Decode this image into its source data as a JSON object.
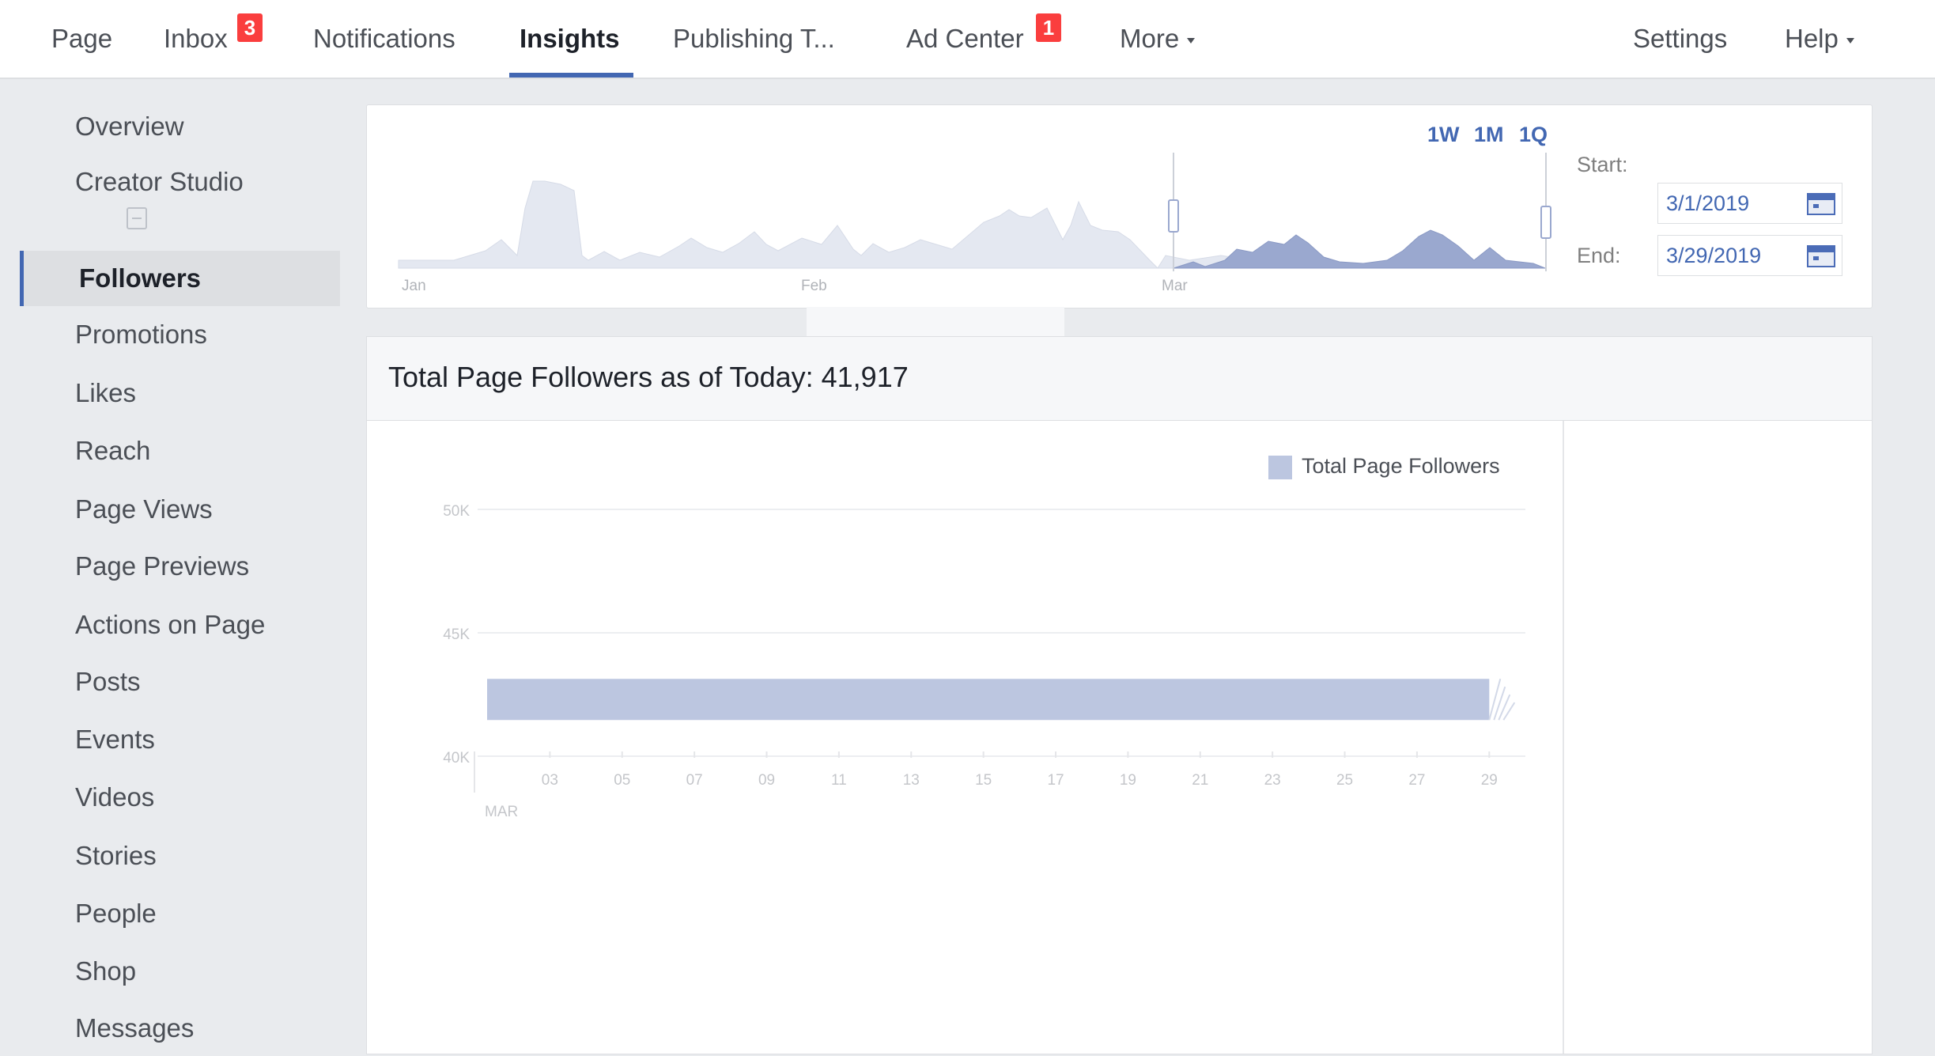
{
  "topnav": {
    "items": [
      {
        "label": "Page"
      },
      {
        "label": "Inbox",
        "badge": "3"
      },
      {
        "label": "Notifications"
      },
      {
        "label": "Insights",
        "active": true
      },
      {
        "label": "Publishing T..."
      },
      {
        "label": "Ad Center",
        "badge": "1"
      },
      {
        "label": "More"
      },
      {
        "label": "Settings"
      },
      {
        "label": "Help"
      }
    ]
  },
  "sidebar": {
    "items": [
      {
        "label": "Overview"
      },
      {
        "label": "Creator Studio"
      },
      {
        "label": "Followers",
        "active": true
      },
      {
        "label": "Promotions"
      },
      {
        "label": "Likes"
      },
      {
        "label": "Reach"
      },
      {
        "label": "Page Views"
      },
      {
        "label": "Page Previews"
      },
      {
        "label": "Actions on Page"
      },
      {
        "label": "Posts"
      },
      {
        "label": "Events"
      },
      {
        "label": "Videos"
      },
      {
        "label": "Stories"
      },
      {
        "label": "People"
      },
      {
        "label": "Shop"
      },
      {
        "label": "Messages"
      }
    ]
  },
  "range": {
    "buttons": [
      "1W",
      "1M",
      "1Q"
    ],
    "start_label": "Start:",
    "end_label": "End:",
    "start_date": "3/1/2019",
    "end_date": "3/29/2019",
    "overview_months": [
      "Jan",
      "Feb",
      "Mar"
    ]
  },
  "summary": {
    "title": "Total Page Followers as of Today: 41,917"
  },
  "chart_data": {
    "type": "area",
    "title": "",
    "legend": [
      "Total Page Followers"
    ],
    "legend_position": "top-right",
    "y_ticks": [
      "50K",
      "45K",
      "40K"
    ],
    "ylim": [
      40000,
      50000
    ],
    "x_ticks": [
      "03",
      "05",
      "07",
      "09",
      "11",
      "13",
      "15",
      "17",
      "19",
      "21",
      "23",
      "25",
      "27",
      "29"
    ],
    "x_month_label": "MAR",
    "series": [
      {
        "name": "Total Page Followers",
        "x": [
          1,
          29
        ],
        "values": [
          41917,
          41917
        ]
      }
    ],
    "colors": {
      "series": "#bcc6e0",
      "overview_fill": "#e4e8f1",
      "overview_selected": "#9aa8cf"
    }
  },
  "colors": {
    "accent": "#4267b2",
    "badge": "#fa3e3e"
  }
}
